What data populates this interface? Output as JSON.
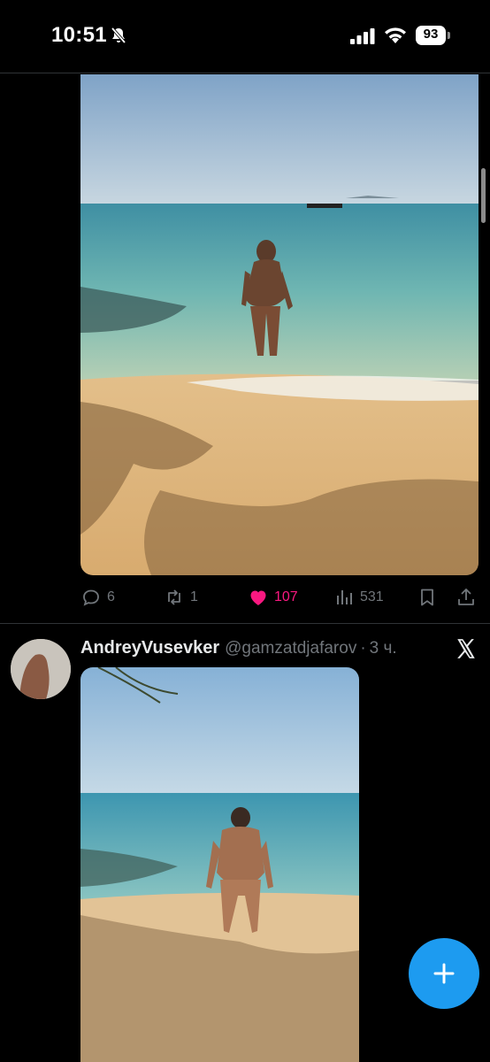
{
  "status_bar": {
    "time": "10:51",
    "battery": "93",
    "icons": [
      "bell-slash-icon",
      "signal-icon",
      "wifi-icon",
      "battery-icon"
    ]
  },
  "post1": {
    "media": {
      "type": "photo",
      "description_icon": "beach-photo"
    },
    "actions": {
      "replies": "6",
      "reposts": "1",
      "likes": "107",
      "views": "531",
      "icons": [
        "reply-icon",
        "repost-icon",
        "heart-icon",
        "views-icon",
        "bookmark-icon",
        "share-icon"
      ]
    },
    "liked": true
  },
  "post2": {
    "display_name": "AndreyVusevker",
    "handle": "@gamzatdjafarov",
    "separator": "·",
    "time": "3 ч.",
    "logo": "x-logo-icon",
    "media": {
      "type": "photo"
    }
  },
  "fab": {
    "icon": "plus-icon"
  },
  "colors": {
    "background": "#000000",
    "text": "#e7e9ea",
    "muted": "#71767b",
    "like": "#f91880",
    "accent": "#1d9bf0",
    "divider": "#2f3336"
  }
}
